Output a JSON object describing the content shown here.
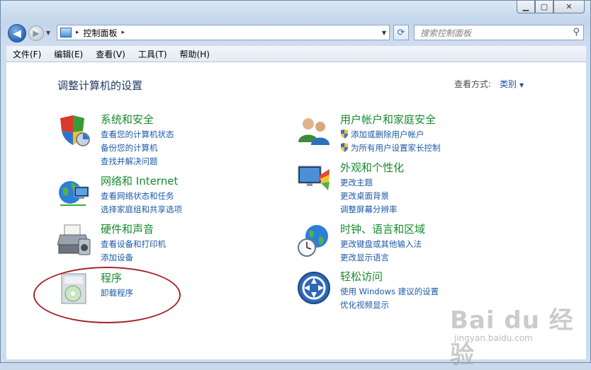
{
  "window_controls": {
    "minimize": "▁",
    "maximize": "▢",
    "close": "✕"
  },
  "nav": {
    "back_glyph": "◀",
    "forward_glyph": "▶",
    "address_root_glyph": "▸",
    "address_label": "控制面板",
    "address_sep": "▸",
    "search_placeholder": "搜索控制面板",
    "search_icon": "search-icon"
  },
  "menu": [
    "文件(F)",
    "编辑(E)",
    "查看(V)",
    "工具(T)",
    "帮助(H)"
  ],
  "page": {
    "title": "调整计算机的设置",
    "view_by_label": "查看方式:",
    "view_by_value": "类别"
  },
  "categories_left": [
    {
      "title": "系统和安全",
      "icon": "shield-icon",
      "links": [
        "查看您的计算机状态",
        "备份您的计算机",
        "查找并解决问题"
      ]
    },
    {
      "title": "网络和 Internet",
      "icon": "globe-network-icon",
      "links": [
        "查看网络状态和任务",
        "选择家庭组和共享选项"
      ]
    },
    {
      "title": "硬件和声音",
      "icon": "printer-icon",
      "links": [
        "查看设备和打印机",
        "添加设备"
      ]
    },
    {
      "title": "程序",
      "icon": "programs-icon",
      "links": [
        "卸载程序"
      ]
    }
  ],
  "categories_right": [
    {
      "title": "用户帐户和家庭安全",
      "icon": "users-icon",
      "links": [
        "添加或删除用户帐户",
        "为所有用户设置家长控制"
      ]
    },
    {
      "title": "外观和个性化",
      "icon": "appearance-icon",
      "links": [
        "更改主题",
        "更改桌面背景",
        "调整屏幕分辨率"
      ]
    },
    {
      "title": "时钟、语言和区域",
      "icon": "clock-globe-icon",
      "links": [
        "更改键盘或其他输入法",
        "更改显示语言"
      ]
    },
    {
      "title": "轻松访问",
      "icon": "ease-of-access-icon",
      "links": [
        "使用 Windows 建议的设置",
        "优化视频显示"
      ]
    }
  ],
  "watermark": {
    "main": "Bai du 经验",
    "sub": "jingyan.baidu.com"
  },
  "colors": {
    "category_title": "#178a2e",
    "link": "#1c5aa6",
    "annotation": "#a4262c"
  }
}
